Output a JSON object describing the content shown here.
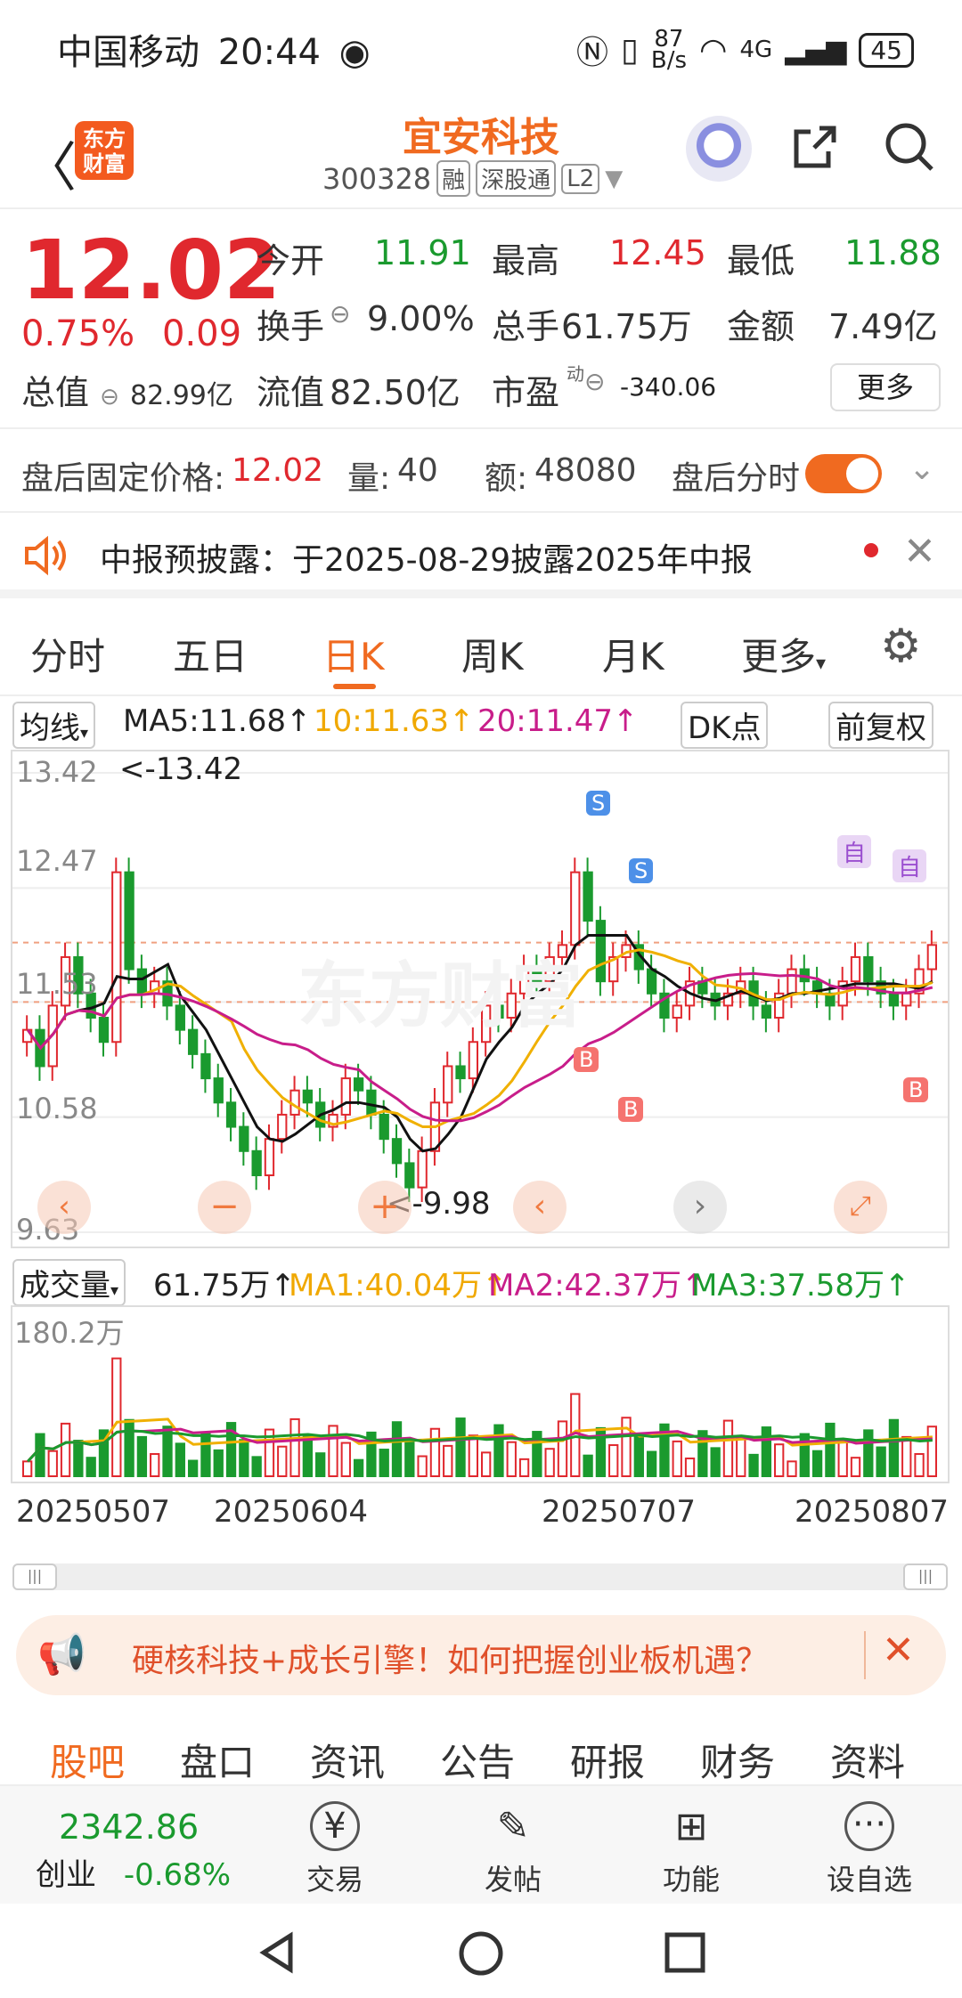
{
  "status": {
    "carrier": "中国移动",
    "time": "20:44",
    "net_speed_top": "87",
    "net_speed_bottom": "B/s",
    "battery": "45",
    "signal": "4G"
  },
  "header": {
    "logo_line1": "东方",
    "logo_line2": "财富",
    "title": "宜安科技",
    "code": "300328",
    "tag1": "融",
    "tag2": "深股通",
    "tag3": "L2"
  },
  "quote": {
    "price": "12.02",
    "pct": "0.75%",
    "change": "0.09",
    "open_label": "今开",
    "open": "11.91",
    "high_label": "最高",
    "high": "12.45",
    "low_label": "最低",
    "low": "11.88",
    "turnover_label": "换手",
    "turnover": "9.00%",
    "volume_label": "总手",
    "volume": "61.75万",
    "amount_label": "金额",
    "amount": "7.49亿",
    "mktcap_label": "总值",
    "mktcap": "82.99亿",
    "float_label": "流值",
    "float": "82.50亿",
    "pe_label": "市盈",
    "pe_sup": "动",
    "pe": "-340.06",
    "more": "更多"
  },
  "afterhours": {
    "label": "盘后固定价格:",
    "price": "12.02",
    "vol_label": "量:",
    "vol": "40",
    "amt_label": "额:",
    "amt": "48080",
    "toggle_label": "盘后分时"
  },
  "notice": {
    "text": "中报预披露：于2025-08-29披露2025年中报"
  },
  "tabs": [
    "分时",
    "五日",
    "日K",
    "周K",
    "月K",
    "更多"
  ],
  "ma": {
    "selector": "均线",
    "ma5": "MA5:11.68↑",
    "ma10": "10:11.63↑",
    "ma20": "20:11.47↑",
    "dk": "DK点",
    "adj": "前复权"
  },
  "chart_labels": {
    "max": "<-13.42",
    "min": "<-9.98",
    "y1": "13.42",
    "y2": "12.47",
    "y3": "11.53",
    "y4": "10.58",
    "y5": "9.63",
    "sig_s": "S",
    "sig_b": "B",
    "sig_zi": "自",
    "watermark": "东方财富"
  },
  "volume": {
    "selector": "成交量",
    "value": "61.75万↑",
    "ma1": "MA1:40.04万↑",
    "ma2": "MA2:42.37万↑",
    "ma3": "MA3:37.58万↑",
    "max": "180.2万"
  },
  "dates": [
    "20250507",
    "20250604",
    "20250707",
    "20250807"
  ],
  "promo": {
    "text": "硬核科技+成长引擎！如何把握创业板机遇？"
  },
  "bottom_tabs": [
    "股吧",
    "盘口",
    "资讯",
    "公告",
    "研报",
    "财务",
    "资料"
  ],
  "nav": {
    "index_value": "2342.86",
    "index_name": "创业",
    "index_change": "-0.68%",
    "trade": "交易",
    "post": "发帖",
    "func": "功能",
    "custom": "设自选"
  },
  "chart_data": {
    "type": "candlestick",
    "ylim": [
      9.63,
      13.42
    ],
    "y_ticks": [
      13.42,
      12.47,
      11.53,
      10.58,
      9.63
    ],
    "period_high": 13.42,
    "period_low": 9.98,
    "x_labels": [
      "20250507",
      "20250604",
      "20250707",
      "20250807"
    ],
    "closes": [
      11.3,
      11.0,
      11.5,
      11.9,
      11.6,
      11.4,
      11.2,
      12.6,
      11.8,
      11.6,
      11.7,
      11.5,
      11.3,
      11.1,
      10.9,
      10.7,
      10.5,
      10.3,
      10.1,
      10.4,
      10.6,
      10.8,
      10.7,
      10.5,
      10.6,
      10.9,
      10.8,
      10.6,
      10.4,
      10.2,
      10.0,
      10.3,
      10.7,
      11.0,
      10.9,
      11.2,
      11.5,
      11.4,
      11.6,
      11.8,
      11.7,
      11.9,
      12.0,
      12.6,
      12.2,
      11.7,
      11.9,
      12.0,
      11.8,
      11.6,
      11.4,
      11.5,
      11.7,
      11.6,
      11.5,
      11.6,
      11.7,
      11.5,
      11.4,
      11.6,
      11.8,
      11.7,
      11.6,
      11.5,
      11.7,
      11.9,
      11.7,
      11.6,
      11.5,
      11.6,
      11.8,
      12.0
    ],
    "volume_unit": "万",
    "volume_max": 180.2,
    "volume_current": 61.75,
    "volume_ma": {
      "MA1": 40.04,
      "MA2": 42.37,
      "MA3": 37.58
    }
  }
}
